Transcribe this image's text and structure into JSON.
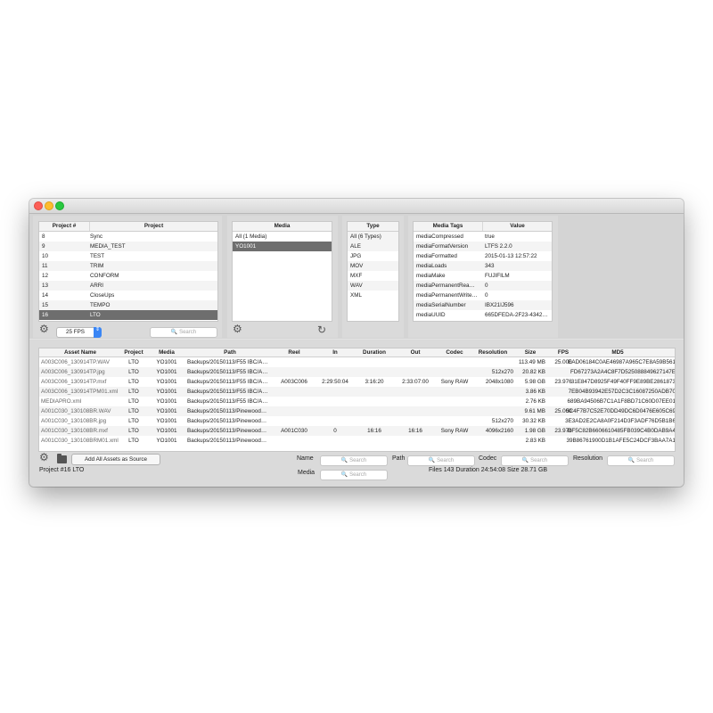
{
  "window": {
    "controls": [
      "close",
      "minimize",
      "maximize"
    ]
  },
  "projects": {
    "headers": [
      "Project #",
      "Project"
    ],
    "rows": [
      [
        "8",
        "Sync"
      ],
      [
        "9",
        "MEDIA_TEST"
      ],
      [
        "10",
        "TEST"
      ],
      [
        "11",
        "TRIM"
      ],
      [
        "12",
        "CONFORM"
      ],
      [
        "13",
        "ARRI"
      ],
      [
        "14",
        "CloseUps"
      ],
      [
        "15",
        "TEMPO"
      ],
      [
        "16",
        "LTO"
      ]
    ],
    "selected_index": 8,
    "fps_value": "25 FPS",
    "search_placeholder": "Search"
  },
  "media": {
    "header": "Media",
    "rows": [
      "All (1 Media)",
      "YO1001"
    ],
    "selected_index": 1
  },
  "types": {
    "header": "Type",
    "rows": [
      "All (6 Types)",
      "ALE",
      "JPG",
      "MOV",
      "MXF",
      "WAV",
      "XML"
    ],
    "selected_index": 0
  },
  "tags": {
    "headers": [
      "Media Tags",
      "Value"
    ],
    "rows": [
      [
        "mediaCompressed",
        "true"
      ],
      [
        "mediaFormatVersion",
        "LTFS 2.2.0"
      ],
      [
        "mediaFormatted",
        "2015-01-13 12:57:22"
      ],
      [
        "mediaLoads",
        "343"
      ],
      [
        "mediaMake",
        "FUJIFILM"
      ],
      [
        "mediaPermanentRea…",
        "0"
      ],
      [
        "mediaPermanentWrite…",
        "0"
      ],
      [
        "mediaSerialNumber",
        "IBX21IJ596"
      ],
      [
        "mediaUUID",
        "665DFEDA-2F23-4342…"
      ]
    ]
  },
  "assets": {
    "headers": [
      "Asset Name",
      "Project",
      "Media",
      "Path",
      "Reel",
      "In",
      "Duration",
      "Out",
      "Codec",
      "Resolution",
      "Size",
      "FPS",
      "MD5"
    ],
    "rows": [
      [
        "A003C006_130914TP.WAV",
        "LTO",
        "YO1001",
        "Backups/20150113/F55 IBC/A…",
        "",
        "",
        "",
        "",
        "",
        "",
        "113.49 MB",
        "25.000",
        "EAD06184C0AE46987A965C7E8A59B561"
      ],
      [
        "A003C006_130914TP.jpg",
        "LTO",
        "YO1001",
        "Backups/20150113/F55 IBC/A…",
        "",
        "",
        "",
        "",
        "",
        "512x270",
        "20.82 KB",
        "",
        "FD67273A2A4C8F7D525088849627147E"
      ],
      [
        "A003C006_130914TP.mxf",
        "LTO",
        "YO1001",
        "Backups/20150113/F55 IBC/A…",
        "A003C006",
        "2:29:50:04",
        "3:16:20",
        "2:33:07:00",
        "Sony RAW",
        "2048x1080",
        "5.98 GB",
        "23.976",
        "31E847D8925F49F40FF9E89BE2861873"
      ],
      [
        "A003C006_130914TPM01.xml",
        "LTO",
        "YO1001",
        "Backups/20150113/F55 IBC/A…",
        "",
        "",
        "",
        "",
        "",
        "",
        "3.86 KB",
        "",
        "7EB04B93942E57D2C3C16087250ADB70"
      ],
      [
        "MEDIAPRO.xml",
        "LTO",
        "YO1001",
        "Backups/20150113/F55 IBC/A…",
        "",
        "",
        "",
        "",
        "",
        "",
        "2.76 KB",
        "",
        "689BA94506B7C1A1F8BD71C60D07EE01"
      ],
      [
        "A001C030_130108BR.WAV",
        "LTO",
        "YO1001",
        "Backups/20150113/Pinewood…",
        "",
        "",
        "",
        "",
        "",
        "",
        "9.61 MB",
        "25.000",
        "5C4F7B7C52E70DD49DC6D0476E605C69"
      ],
      [
        "A001C030_130108BR.jpg",
        "LTO",
        "YO1001",
        "Backups/20150113/Pinewood…",
        "",
        "",
        "",
        "",
        "",
        "512x270",
        "30.32 KB",
        "",
        "3E3AD2E2CA8A0F214D3F3ADF76D5B1B6"
      ],
      [
        "A001C030_130108BR.mxf",
        "LTO",
        "YO1001",
        "Backups/20150113/Pinewood…",
        "A001C030",
        "0",
        "16:16",
        "16:16",
        "Sony RAW",
        "4096x2160",
        "1.98 GB",
        "23.976",
        "DF5C82B6606610485FB039C4B0DAB9A4"
      ],
      [
        "A001C030_130108BRM01.xml",
        "LTO",
        "YO1001",
        "Backups/20150113/Pinewood…",
        "",
        "",
        "",
        "",
        "",
        "",
        "2.83 KB",
        "",
        "39B86761900D1B1AFE5C24DCF3BAA7A1"
      ]
    ]
  },
  "toolbar": {
    "add_all_label": "Add All Assets as Source",
    "name_label": "Name",
    "path_label": "Path",
    "codec_label": "Codec",
    "resolution_label": "Resolution",
    "media_label": "Media",
    "search_placeholder": "Search"
  },
  "status": {
    "project": "Project #16  LTO",
    "summary": "Files 143 Duration 24:54:08 Size 28.71 GB"
  },
  "colors": {
    "selection": "#6e6e6e",
    "stepper": "#3a86f5"
  },
  "icons": [
    "gear-icon",
    "folder-icon",
    "refresh-icon",
    "search-icon"
  ]
}
